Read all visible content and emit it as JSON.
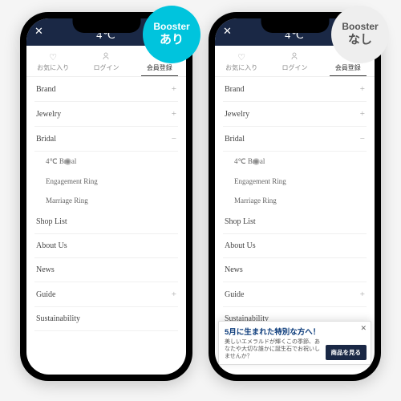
{
  "badges": {
    "booster_label": "Booster",
    "on": "あり",
    "off": "なし"
  },
  "header": {
    "logo": "4℃",
    "close": "✕"
  },
  "tabs": [
    {
      "icon": "♡",
      "label": "お気に入り"
    },
    {
      "icon": "°",
      "label": "ログイン",
      "iconType": "person"
    },
    {
      "icon": "✎",
      "label": "会員登録",
      "active": true
    }
  ],
  "menu": [
    {
      "label": "Brand",
      "expand": "+"
    },
    {
      "label": "Jewelry",
      "expand": "+"
    },
    {
      "label": "Bridal",
      "expand": "−",
      "open": true
    },
    {
      "sub": true,
      "label": "4℃ Br",
      "cursor": true,
      "suffix": "al"
    },
    {
      "sub": true,
      "label": "Engagement Ring"
    },
    {
      "sub": true,
      "label": "Marriage Ring"
    },
    {
      "label": "Shop List"
    },
    {
      "label": "About Us"
    },
    {
      "label": "News"
    },
    {
      "label": "Guide",
      "expand": "+"
    },
    {
      "label": "Sustainability"
    }
  ],
  "popup": {
    "title": "5月に生まれた特別な方へ！",
    "body": "美しいエメラルドが輝くこの季節、あなたや大切な誰かに誕生石でお祝いしませんか？",
    "close": "✕",
    "button": "商品を見る"
  }
}
